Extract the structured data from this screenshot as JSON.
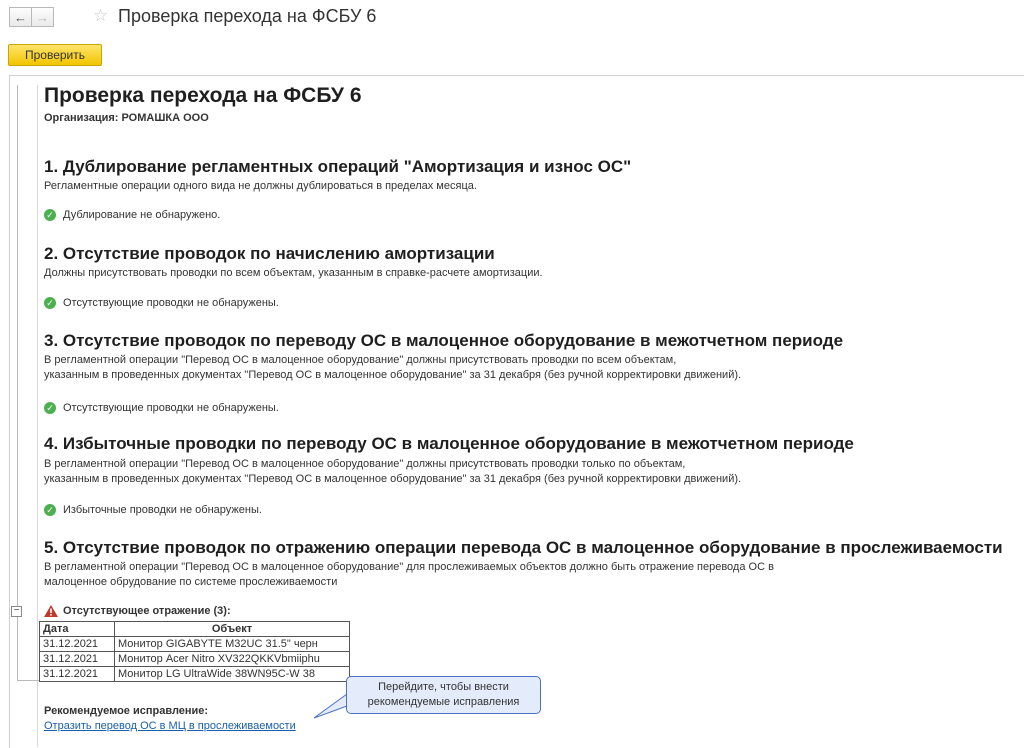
{
  "window": {
    "title": "Проверка перехода на ФСБУ 6",
    "back_icon": "arrow-left",
    "forward_icon": "arrow-right",
    "favorite_icon": "star"
  },
  "toolbar": {
    "check_label": "Проверить"
  },
  "report": {
    "title": "Проверка перехода на ФСБУ 6",
    "organization": "Организация: РОМАШКА ООО",
    "sections": [
      {
        "title": "1. Дублирование регламентных операций \"Амортизация и износ ОС\"",
        "desc_lines": [
          "Регламентные операции одного вида не должны дублироваться в пределах месяца."
        ],
        "result": "Дублирование не обнаружено."
      },
      {
        "title": "2. Отсутствие проводок по начислению амортизации",
        "desc_lines": [
          "Должны присутствовать проводки по всем объектам, указанным в справке-расчете амортизации."
        ],
        "result": "Отсутствующие проводки не обнаружены."
      },
      {
        "title": "3. Отсутствие проводок по переводу ОС в малоценное оборудование в межотчетном периоде",
        "desc_lines": [
          "В регламентной операции \"Перевод ОС в малоценное оборудование\" должны присутствовать проводки по всем объектам,",
          "указанным в проведенных документах \"Перевод ОС в малоценное оборудование\" за 31 декабря (без ручной корректировки движений)."
        ],
        "result": "Отсутствующие проводки не обнаружены."
      },
      {
        "title": "4. Избыточные проводки по переводу ОС в малоценное оборудование в межотчетном периоде",
        "desc_lines": [
          "В регламентной операции \"Перевод ОС в малоценное оборудование\" должны присутствовать проводки только по объектам,",
          "указанным в проведенных документах \"Перевод ОС в малоценное оборудование\" за 31 декабря (без ручной корректировки движений)."
        ],
        "result": "Избыточные проводки не обнаружены."
      },
      {
        "title": "5. Отсутствие проводок по отражению операции перевода ОС  в малоценное оборудование в прослеживаемости",
        "desc_lines": [
          "В регламентной операции \"Перевод ОС в малоценное оборудование\" для прослеживаемых объектов должно быть отражение перевода ОС в",
          " малоценное обрудование по системе прослеживаемости"
        ],
        "warning": "Отсутствующее отражение (3):",
        "table": {
          "headers": [
            "Дата",
            "Объект"
          ],
          "rows": [
            [
              "31.12.2021",
              "Монитор GIGABYTE M32UC 31.5\" черн"
            ],
            [
              "31.12.2021",
              "Монитор Acer Nitro XV322QKKVbmiiphu"
            ],
            [
              "31.12.2021",
              "Монитор LG UltraWide 38WN95C-W 38"
            ]
          ]
        },
        "recommendation_label": "Рекомендуемое исправление:",
        "recommendation_link": "Отразить перевод ОС в МЦ в прослеживаемости"
      }
    ]
  },
  "tooltip": {
    "line1": "Перейдите, чтобы внести",
    "line2": "рекомендуемые исправления"
  },
  "colors": {
    "accent_button": "#f3c400",
    "link": "#1a5fa8",
    "ok": "#4caf50",
    "warning": "#c0392b",
    "tooltip_bg": "#e4ecfb"
  }
}
